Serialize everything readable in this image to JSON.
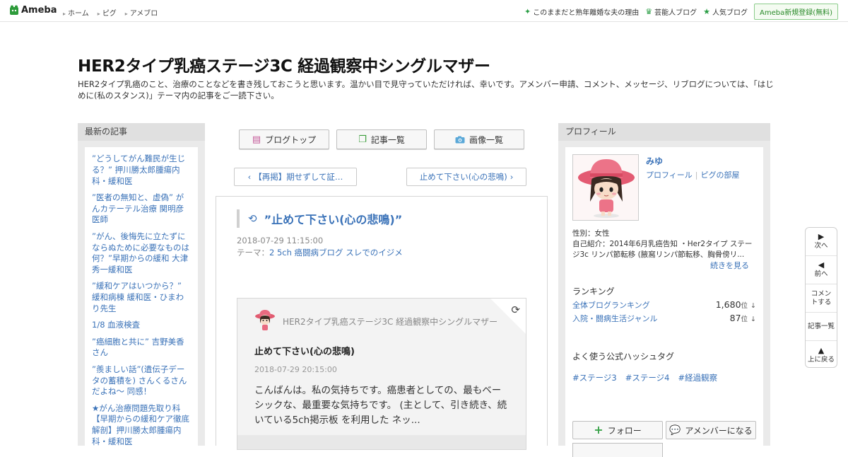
{
  "topbar": {
    "logo_text": "Ameba",
    "nav": [
      "ホーム",
      "ピグ",
      "アメブロ"
    ],
    "right_links": [
      {
        "label": "このままだと熟年離婚な夫の理由",
        "icon": "sparkle-icon"
      },
      {
        "label": "芸能人ブログ",
        "icon": "crown-icon"
      },
      {
        "label": "人気ブログ",
        "icon": "star-icon"
      }
    ],
    "signup_label": "Ameba新規登録(無料)"
  },
  "header": {
    "title": "HER2タイプ乳癌ステージ3C 経過観察中シングルマザー",
    "description": "HER2タイプ乳癌のこと、治療のことなどを書き残しておこうと思います。温かい目で見守っていただければ、幸いです。アメンバー申請、コメント、メッセージ、リブログについては、「はじめに(私のスタンス)」テーマ内の記事をご一読下さい。"
  },
  "left": {
    "heading": "最新の記事",
    "items": [
      "”どうしてがん難民が生じる？” 押川勝太郎腫瘍内科・緩和医",
      "”医者の無知と、虚偽” がんカテーテル治療 関明彦医師",
      "”がん、後悔先に立たずにならぬために必要なものは何？”早期からの緩和 大津秀一緩和医",
      "”緩和ケアはいつから？” 緩和病棟 緩和医・ひまわり先生",
      "1/8 血液検査",
      "”癌細胞と共に” 吉野美香さん",
      "”羨ましい話”(遺伝子データの蓄積を) さんくるさんだよね～ 同感！",
      "★がん治療問題先取り科【早期からの緩和ケア徹底解剖】押川勝太郎腫瘍内科・緩和医"
    ]
  },
  "center": {
    "buttons": [
      {
        "label": "ブログトップ",
        "icon": "document-icon"
      },
      {
        "label": "記事一覧",
        "icon": "copy-icon"
      },
      {
        "label": "画像一覧",
        "icon": "camera-icon"
      }
    ],
    "prev_label": "【再掲】期せずして証…",
    "next_label": "止めて下さい(心の悲鳴)",
    "article": {
      "title": "”止めて下さい(心の悲鳴)”",
      "date": "2018-07-29 11:15:00",
      "theme_prefix": "テーマ：",
      "theme": "2 5ch 癌闘病ブログ スレでのイジメ"
    },
    "reblog": {
      "blog_name": "HER2タイプ乳癌ステージ3C 経過観察中シングルマザー",
      "title": "止めて下さい(心の悲鳴)",
      "date": "2018-07-29 20:15:00",
      "body": "こんばんは。私の気持ちです。癌患者としての、最もベーシックな、最重要な気持ちです。 (主として、引き続き、続いている5ch掲示板 を利用した ネッ..."
    }
  },
  "right": {
    "heading": "プロフィール",
    "name": "みゆ",
    "link_profile": "プロフィール",
    "link_room": "ピグの部屋",
    "gender": "性別：女性",
    "intro": "自己紹介：2014年6月乳癌告知 ・Her2タイプ ステージ3c リンパ節転移 (腋窩リンパ節転移、胸骨傍リ...",
    "more_label": "続きを見る",
    "ranking_heading": "ランキング",
    "rankings": [
      {
        "label": "全体ブログランキング",
        "value": "1,680",
        "unit": "位",
        "trend": "↓"
      },
      {
        "label": "入院・闘病生活ジャンル",
        "value": "87",
        "unit": "位",
        "trend": "↓"
      }
    ],
    "hashtag_heading": "よく使う公式ハッシュタグ",
    "hashtags": [
      "#ステージ3",
      "#ステージ4",
      "#経過観察"
    ],
    "follow_label": "フォロー",
    "member_label": "アメンバーになる"
  },
  "sidenav": [
    {
      "label": "次へ",
      "icon": "play-right-icon"
    },
    {
      "label": "前へ",
      "icon": "play-left-icon"
    },
    {
      "label": "コメントする",
      "icon": ""
    },
    {
      "label": "記事一覧",
      "icon": ""
    },
    {
      "label": "上に戻る",
      "icon": "up-arrow-icon"
    }
  ]
}
